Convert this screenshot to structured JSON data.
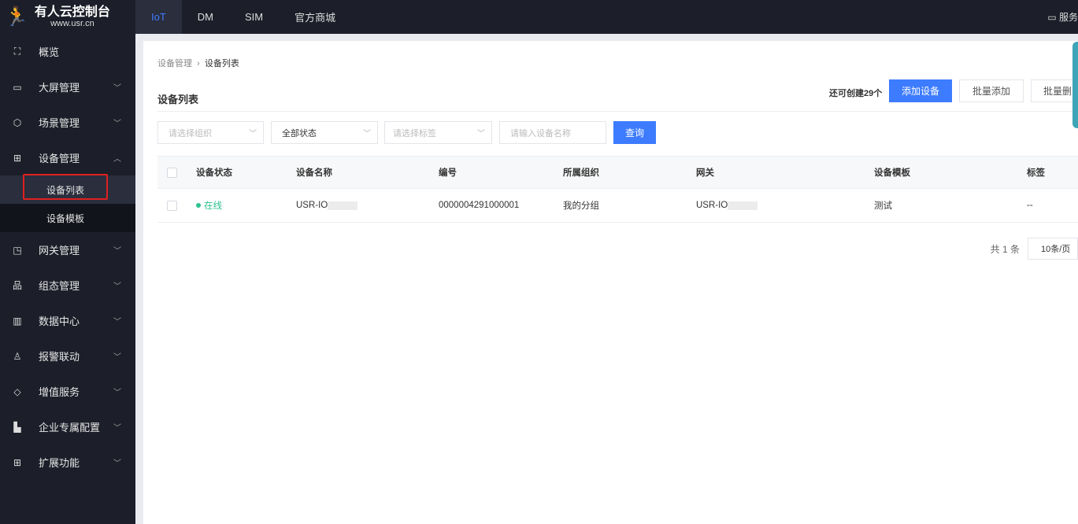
{
  "brand": {
    "name": "有人云控制台",
    "url": "www.usr.cn"
  },
  "top_tabs": [
    {
      "label": "IoT",
      "active": true
    },
    {
      "label": "DM"
    },
    {
      "label": "SIM"
    },
    {
      "label": "官方商城"
    }
  ],
  "top_right": {
    "service": "服务"
  },
  "sidebar": {
    "items": [
      {
        "label": "概览",
        "icon": "overview-icon"
      },
      {
        "label": "大屏管理",
        "icon": "screen-icon"
      },
      {
        "label": "场景管理",
        "icon": "cube-icon"
      },
      {
        "label": "设备管理",
        "icon": "device-icon",
        "expanded": true,
        "children": [
          {
            "label": "设备列表",
            "active": true
          },
          {
            "label": "设备模板"
          }
        ]
      },
      {
        "label": "网关管理",
        "icon": "gateway-icon"
      },
      {
        "label": "组态管理",
        "icon": "topology-icon"
      },
      {
        "label": "数据中心",
        "icon": "bar-chart-icon"
      },
      {
        "label": "报警联动",
        "icon": "alarm-icon"
      },
      {
        "label": "增值服务",
        "icon": "diamond-icon"
      },
      {
        "label": "企业专属配置",
        "icon": "building-icon"
      },
      {
        "label": "扩展功能",
        "icon": "grid-icon"
      }
    ]
  },
  "breadcrumb": [
    "设备管理",
    "设备列表"
  ],
  "page_title": "设备列表",
  "quota": "还可创建29个",
  "actions": {
    "add": "添加设备",
    "batch_add": "批量添加",
    "batch_delete": "批量删"
  },
  "filters": {
    "org_placeholder": "请选择组织",
    "status": "全部状态",
    "tag_placeholder": "请选择标签",
    "name_placeholder": "请输入设备名称",
    "query": "查询"
  },
  "table": {
    "columns": [
      "设备状态",
      "设备名称",
      "编号",
      "所属组织",
      "网关",
      "设备模板",
      "标签"
    ],
    "rows": [
      {
        "status": "在线",
        "name": "USR-IO",
        "number": "0000004291000001",
        "org": "我的分组",
        "gateway": "USR-IO",
        "template": "测试",
        "tag": "--"
      }
    ]
  },
  "pagination": {
    "total": "共 1 条",
    "page_size": "10条/页"
  },
  "colors": {
    "primary": "#3d7cff",
    "online": "#2cc38d",
    "sidebar_bg": "#1c1f29"
  }
}
